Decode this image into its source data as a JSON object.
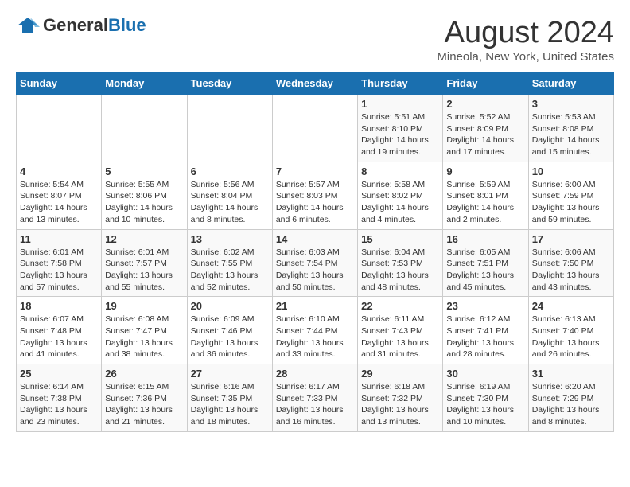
{
  "logo": {
    "general": "General",
    "blue": "Blue"
  },
  "title": "August 2024",
  "location": "Mineola, New York, United States",
  "days_of_week": [
    "Sunday",
    "Monday",
    "Tuesday",
    "Wednesday",
    "Thursday",
    "Friday",
    "Saturday"
  ],
  "weeks": [
    [
      {
        "day": "",
        "info": ""
      },
      {
        "day": "",
        "info": ""
      },
      {
        "day": "",
        "info": ""
      },
      {
        "day": "",
        "info": ""
      },
      {
        "day": "1",
        "info": "Sunrise: 5:51 AM\nSunset: 8:10 PM\nDaylight: 14 hours\nand 19 minutes."
      },
      {
        "day": "2",
        "info": "Sunrise: 5:52 AM\nSunset: 8:09 PM\nDaylight: 14 hours\nand 17 minutes."
      },
      {
        "day": "3",
        "info": "Sunrise: 5:53 AM\nSunset: 8:08 PM\nDaylight: 14 hours\nand 15 minutes."
      }
    ],
    [
      {
        "day": "4",
        "info": "Sunrise: 5:54 AM\nSunset: 8:07 PM\nDaylight: 14 hours\nand 13 minutes."
      },
      {
        "day": "5",
        "info": "Sunrise: 5:55 AM\nSunset: 8:06 PM\nDaylight: 14 hours\nand 10 minutes."
      },
      {
        "day": "6",
        "info": "Sunrise: 5:56 AM\nSunset: 8:04 PM\nDaylight: 14 hours\nand 8 minutes."
      },
      {
        "day": "7",
        "info": "Sunrise: 5:57 AM\nSunset: 8:03 PM\nDaylight: 14 hours\nand 6 minutes."
      },
      {
        "day": "8",
        "info": "Sunrise: 5:58 AM\nSunset: 8:02 PM\nDaylight: 14 hours\nand 4 minutes."
      },
      {
        "day": "9",
        "info": "Sunrise: 5:59 AM\nSunset: 8:01 PM\nDaylight: 14 hours\nand 2 minutes."
      },
      {
        "day": "10",
        "info": "Sunrise: 6:00 AM\nSunset: 7:59 PM\nDaylight: 13 hours\nand 59 minutes."
      }
    ],
    [
      {
        "day": "11",
        "info": "Sunrise: 6:01 AM\nSunset: 7:58 PM\nDaylight: 13 hours\nand 57 minutes."
      },
      {
        "day": "12",
        "info": "Sunrise: 6:01 AM\nSunset: 7:57 PM\nDaylight: 13 hours\nand 55 minutes."
      },
      {
        "day": "13",
        "info": "Sunrise: 6:02 AM\nSunset: 7:55 PM\nDaylight: 13 hours\nand 52 minutes."
      },
      {
        "day": "14",
        "info": "Sunrise: 6:03 AM\nSunset: 7:54 PM\nDaylight: 13 hours\nand 50 minutes."
      },
      {
        "day": "15",
        "info": "Sunrise: 6:04 AM\nSunset: 7:53 PM\nDaylight: 13 hours\nand 48 minutes."
      },
      {
        "day": "16",
        "info": "Sunrise: 6:05 AM\nSunset: 7:51 PM\nDaylight: 13 hours\nand 45 minutes."
      },
      {
        "day": "17",
        "info": "Sunrise: 6:06 AM\nSunset: 7:50 PM\nDaylight: 13 hours\nand 43 minutes."
      }
    ],
    [
      {
        "day": "18",
        "info": "Sunrise: 6:07 AM\nSunset: 7:48 PM\nDaylight: 13 hours\nand 41 minutes."
      },
      {
        "day": "19",
        "info": "Sunrise: 6:08 AM\nSunset: 7:47 PM\nDaylight: 13 hours\nand 38 minutes."
      },
      {
        "day": "20",
        "info": "Sunrise: 6:09 AM\nSunset: 7:46 PM\nDaylight: 13 hours\nand 36 minutes."
      },
      {
        "day": "21",
        "info": "Sunrise: 6:10 AM\nSunset: 7:44 PM\nDaylight: 13 hours\nand 33 minutes."
      },
      {
        "day": "22",
        "info": "Sunrise: 6:11 AM\nSunset: 7:43 PM\nDaylight: 13 hours\nand 31 minutes."
      },
      {
        "day": "23",
        "info": "Sunrise: 6:12 AM\nSunset: 7:41 PM\nDaylight: 13 hours\nand 28 minutes."
      },
      {
        "day": "24",
        "info": "Sunrise: 6:13 AM\nSunset: 7:40 PM\nDaylight: 13 hours\nand 26 minutes."
      }
    ],
    [
      {
        "day": "25",
        "info": "Sunrise: 6:14 AM\nSunset: 7:38 PM\nDaylight: 13 hours\nand 23 minutes."
      },
      {
        "day": "26",
        "info": "Sunrise: 6:15 AM\nSunset: 7:36 PM\nDaylight: 13 hours\nand 21 minutes."
      },
      {
        "day": "27",
        "info": "Sunrise: 6:16 AM\nSunset: 7:35 PM\nDaylight: 13 hours\nand 18 minutes."
      },
      {
        "day": "28",
        "info": "Sunrise: 6:17 AM\nSunset: 7:33 PM\nDaylight: 13 hours\nand 16 minutes."
      },
      {
        "day": "29",
        "info": "Sunrise: 6:18 AM\nSunset: 7:32 PM\nDaylight: 13 hours\nand 13 minutes."
      },
      {
        "day": "30",
        "info": "Sunrise: 6:19 AM\nSunset: 7:30 PM\nDaylight: 13 hours\nand 10 minutes."
      },
      {
        "day": "31",
        "info": "Sunrise: 6:20 AM\nSunset: 7:29 PM\nDaylight: 13 hours\nand 8 minutes."
      }
    ]
  ]
}
